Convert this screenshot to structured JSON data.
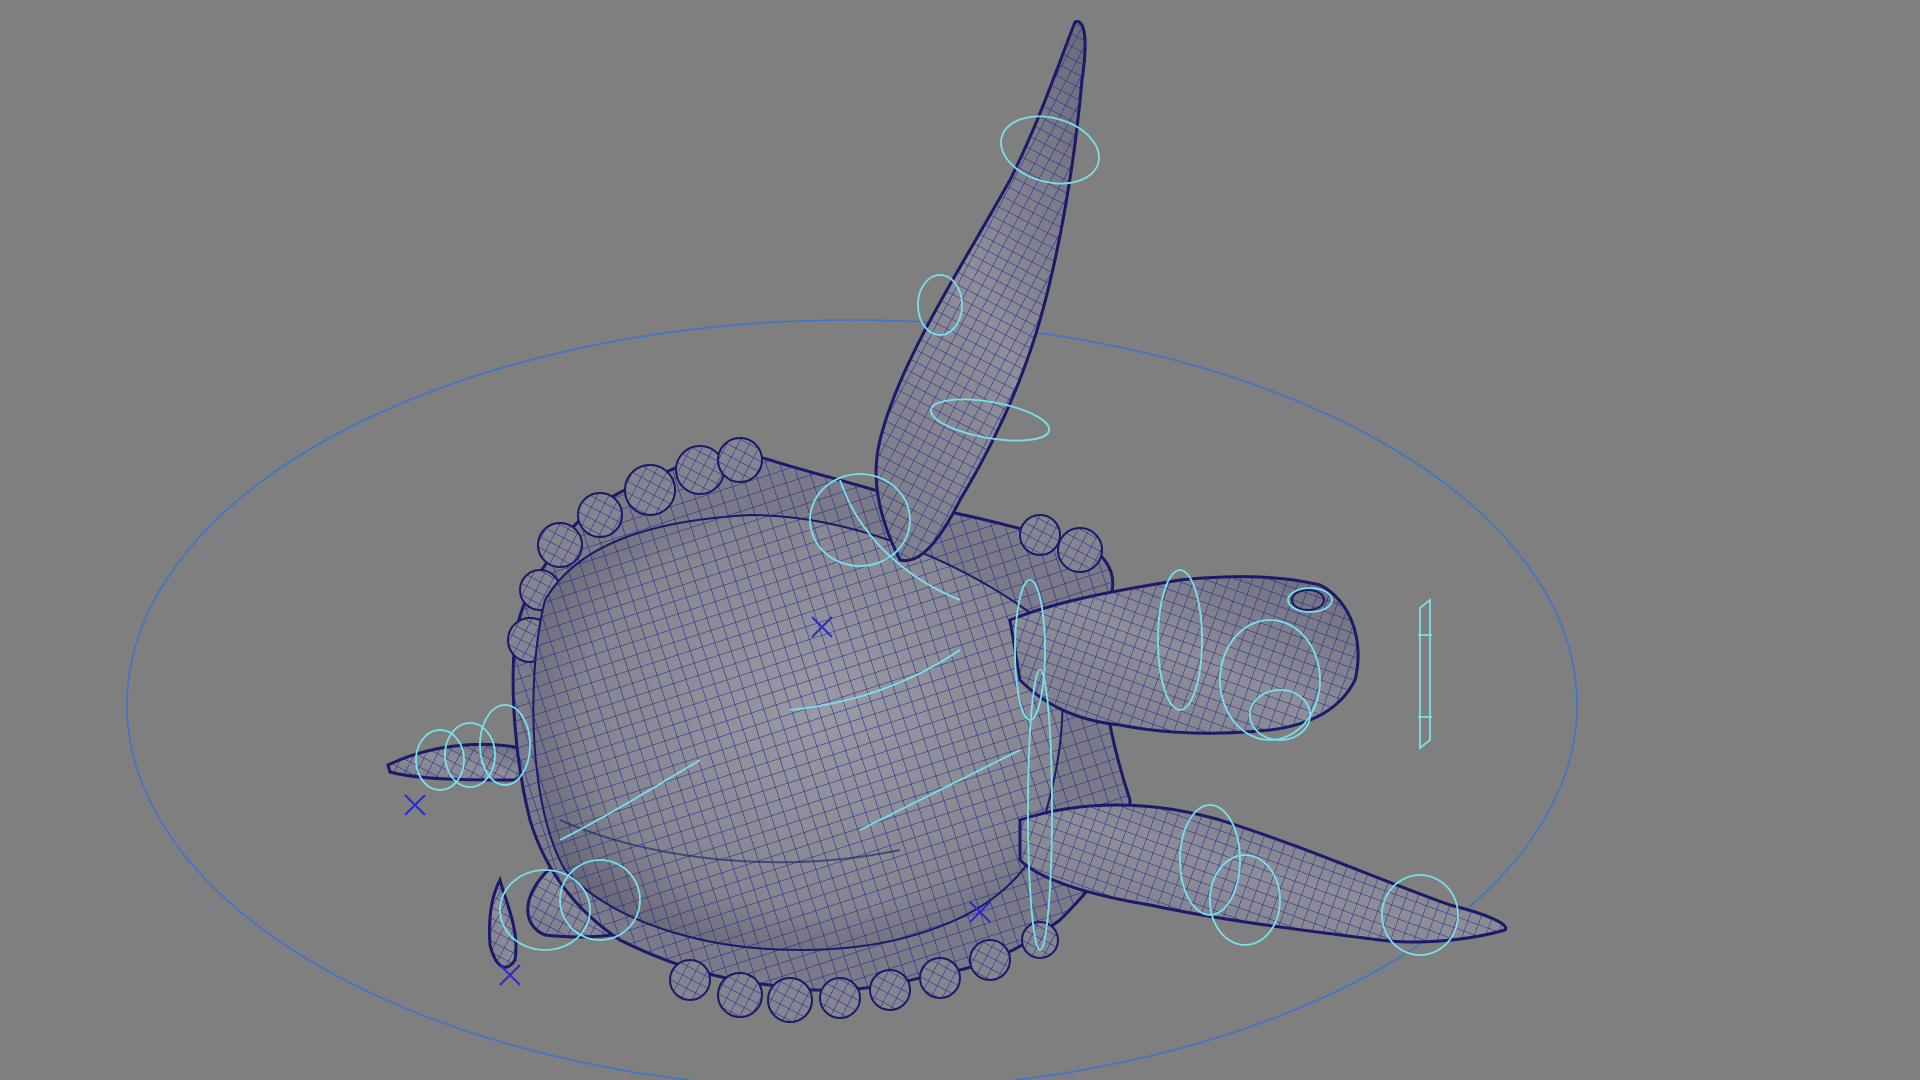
{
  "viewport": {
    "background_color": "#7f7f7f"
  },
  "scene": {
    "object": "sea-turtle",
    "display_mode": "shaded-with-wireframe",
    "colors": {
      "mesh_fill": "#858591",
      "mesh_fill_dark": "#6c6c7c",
      "wireframe": "#23238f",
      "wire_outline": "#1a1a66",
      "control_curve": "#79e0ea",
      "root_control": "#3f74cc",
      "locator": "#2a2ad0"
    },
    "controls": {
      "root_control": "global-root-circle",
      "locators": [
        "tail-locator",
        "back-locator",
        "shell-locator",
        "rear-locator"
      ]
    }
  }
}
